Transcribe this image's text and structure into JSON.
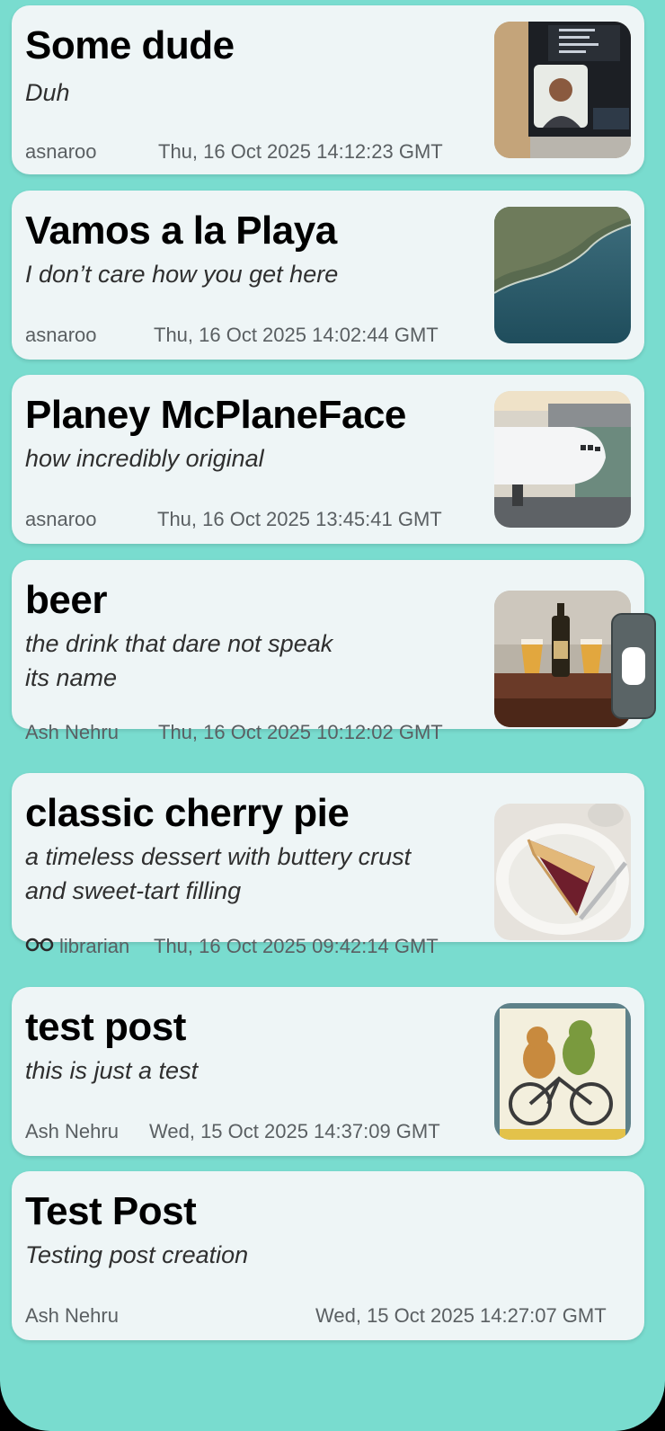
{
  "posts": [
    {
      "title": "Some dude",
      "subtitle": "Duh",
      "author": "asnaroo",
      "date": "Thu, 16 Oct 2025 14:12:23 GMT",
      "thumbnail": "photo-person-laptop-icon"
    },
    {
      "title": "Vamos a la Playa",
      "subtitle": "I don’t care how you get here",
      "author": "asnaroo",
      "date": "Thu, 16 Oct 2025 14:02:44 GMT",
      "thumbnail": "photo-coastline-icon"
    },
    {
      "title": "Planey McPlaneFace",
      "subtitle": "how incredibly original",
      "author": "asnaroo",
      "date": "Thu, 16 Oct 2025 13:45:41 GMT",
      "thumbnail": "photo-airplane-icon"
    },
    {
      "title": "beer",
      "subtitle_lines": [
        "the drink that dare not speak",
        "its name"
      ],
      "author": "Ash Nehru",
      "date": "Thu, 16 Oct 2025 10:12:02 GMT",
      "thumbnail": "photo-beer-icon"
    },
    {
      "title": "classic cherry pie",
      "subtitle_lines": [
        "a timeless dessert with buttery crust",
        "and sweet-tart filling"
      ],
      "author_icon": "glasses-icon",
      "author": "librarian",
      "date": "Thu, 16 Oct 2025 09:42:14 GMT",
      "thumbnail": "photo-cherry-pie-icon"
    },
    {
      "title": "test post",
      "subtitle": "this is just a test",
      "author": "Ash Nehru",
      "date": "Wed, 15 Oct 2025 14:37:09 GMT",
      "thumbnail": "photo-frog-toad-bicycle-icon"
    },
    {
      "title": "Test Post",
      "subtitle": "Testing post creation",
      "author": "Ash Nehru",
      "date": "Wed, 15 Oct 2025 14:27:07 GMT"
    }
  ],
  "colors": {
    "background": "#79dccf",
    "card": "#eef5f6",
    "title": "#000000",
    "meta": "#5a5f62"
  }
}
